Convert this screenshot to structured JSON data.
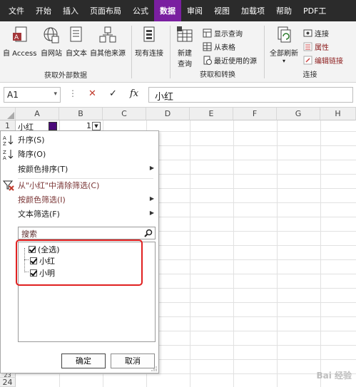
{
  "tabs": [
    {
      "label": "文件",
      "active": false
    },
    {
      "label": "开始",
      "active": false
    },
    {
      "label": "插入",
      "active": false
    },
    {
      "label": "页面布局",
      "active": false
    },
    {
      "label": "公式",
      "active": false
    },
    {
      "label": "数据",
      "active": true
    },
    {
      "label": "审阅",
      "active": false
    },
    {
      "label": "视图",
      "active": false
    },
    {
      "label": "加载项",
      "active": false
    },
    {
      "label": "帮助",
      "active": false
    },
    {
      "label": "PDF工",
      "active": false
    }
  ],
  "ribbon": {
    "external": {
      "label": "获取外部数据",
      "access": "自 Access",
      "web": "自网站",
      "text": "自文本",
      "other": "自其他来源",
      "existing": "现有连接"
    },
    "transform": {
      "label": "获取和转换",
      "newquery_line1": "新建",
      "newquery_line2": "查询",
      "show_queries": "显示查询",
      "from_table": "从表格",
      "recent_sources": "最近使用的源"
    },
    "connections": {
      "label": "连接",
      "refresh_all": "全部刷新",
      "connections": "连接",
      "properties": "属性",
      "edit_links": "编辑链接"
    }
  },
  "formula_bar": {
    "name_box": "A1",
    "formula": "小红",
    "cancel_symbol": "✕",
    "enter_symbol": "✓",
    "fx_symbol": "fx"
  },
  "grid": {
    "columns": [
      "A",
      "B",
      "C",
      "D",
      "E",
      "F",
      "G",
      "H"
    ],
    "row1": {
      "row": "1",
      "a1": "小红",
      "b1": "1"
    },
    "bottom_rows": [
      "23",
      "24"
    ]
  },
  "filter_menu": {
    "sort_asc": "升序(S)",
    "sort_desc": "降序(O)",
    "sort_color": "按颜色排序(T)",
    "clear_filter": "从\"小红\"中清除筛选(C)",
    "filter_color": "按颜色筛选(I)",
    "text_filter": "文本筛选(F)",
    "search_placeholder": "搜索",
    "items": [
      {
        "label": "(全选)",
        "checked": true
      },
      {
        "label": "小红",
        "checked": true
      },
      {
        "label": "小明",
        "checked": true
      }
    ],
    "ok": "确定",
    "cancel": "取消"
  },
  "colors": {
    "active_tab": "#7a1fa0",
    "tabbar": "#2b2b2b",
    "highlight_box": "#e02020"
  },
  "watermark": "Bai 经验"
}
